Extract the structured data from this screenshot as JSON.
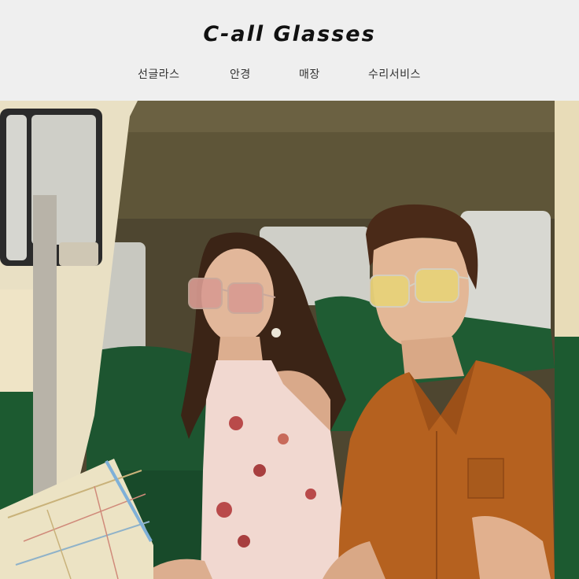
{
  "brand": {
    "name": "C-all Glasses"
  },
  "nav": {
    "items": [
      {
        "label": "선글라스"
      },
      {
        "label": "안경"
      },
      {
        "label": "매장"
      },
      {
        "label": "수리서비스"
      }
    ]
  },
  "hero": {
    "alt_subject": "hero-photo",
    "colors": {
      "van_interior": "#5a5033",
      "seat_green": "#1f5a32",
      "van_cream": "#e8dcb8",
      "shirt_orange": "#b5611f",
      "dress_pink": "#f1d8d0"
    }
  }
}
